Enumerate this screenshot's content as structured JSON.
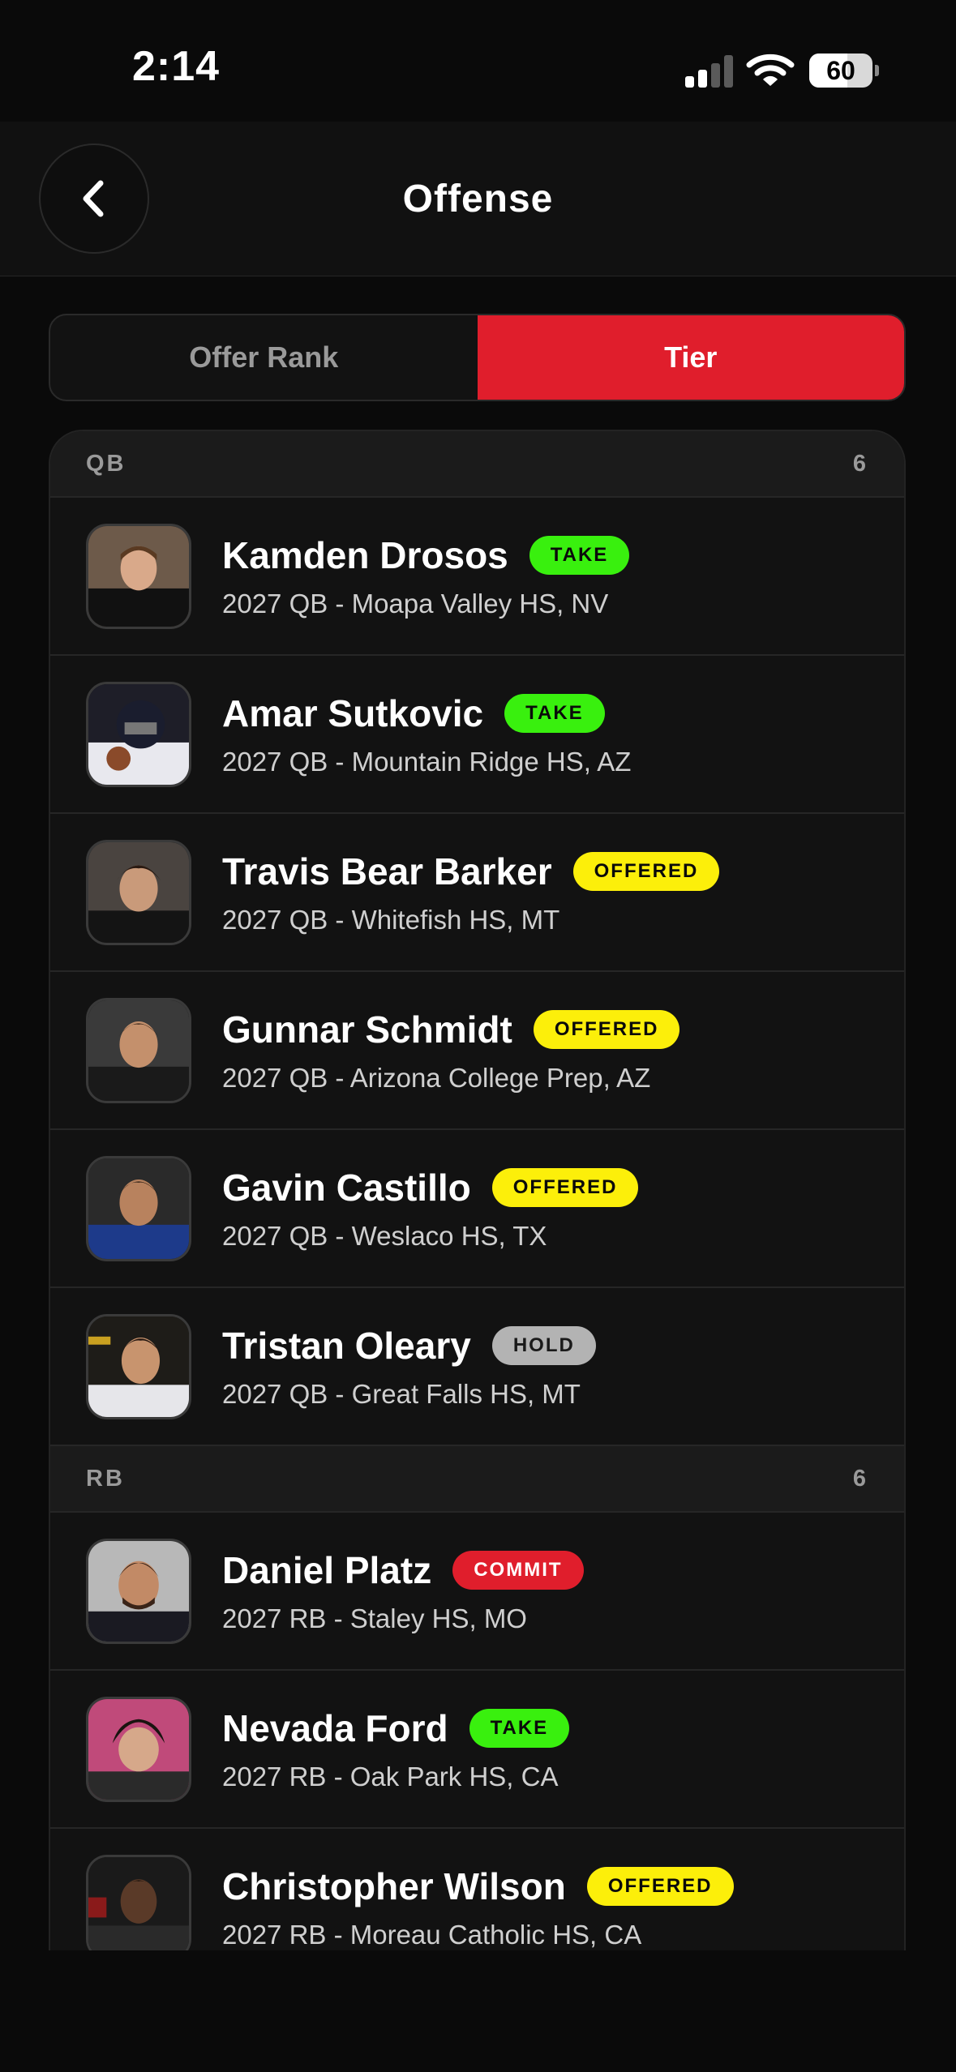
{
  "status_bar": {
    "time": "2:14",
    "battery": "60",
    "battery_level": 0.6
  },
  "header": {
    "title": "Offense"
  },
  "segments": [
    {
      "label": "Offer Rank",
      "active": false
    },
    {
      "label": "Tier",
      "active": true
    }
  ],
  "badge_colors": {
    "take": "#39f00e",
    "offered": "#fcef0a",
    "hold": "#b3b3b3",
    "commit": "#e01e2c"
  },
  "sections": [
    {
      "title": "QB",
      "count": "6",
      "players": [
        {
          "name": "Kamden Drosos",
          "badge": "TAKE",
          "badge_type": "take",
          "details": "2027 QB - Moapa Valley HS, NV"
        },
        {
          "name": "Amar Sutkovic",
          "badge": "TAKE",
          "badge_type": "take",
          "details": "2027 QB - Mountain Ridge HS, AZ"
        },
        {
          "name": "Travis Bear Barker",
          "badge": "OFFERED",
          "badge_type": "offered",
          "details": "2027 QB - Whitefish HS, MT"
        },
        {
          "name": "Gunnar Schmidt",
          "badge": "OFFERED",
          "badge_type": "offered",
          "details": "2027 QB - Arizona College Prep, AZ"
        },
        {
          "name": "Gavin Castillo",
          "badge": "OFFERED",
          "badge_type": "offered",
          "details": "2027 QB - Weslaco HS, TX"
        },
        {
          "name": "Tristan Oleary",
          "badge": "HOLD",
          "badge_type": "hold",
          "details": "2027 QB - Great Falls HS, MT"
        }
      ]
    },
    {
      "title": "RB",
      "count": "6",
      "players": [
        {
          "name": "Daniel Platz",
          "badge": "COMMIT",
          "badge_type": "commit",
          "details": "2027 RB - Staley HS, MO"
        },
        {
          "name": "Nevada Ford",
          "badge": "TAKE",
          "badge_type": "take",
          "details": "2027 RB - Oak Park HS, CA"
        },
        {
          "name": "Christopher Wilson",
          "badge": "OFFERED",
          "badge_type": "offered",
          "details": "2027 RB - Moreau Catholic HS, CA"
        }
      ]
    }
  ]
}
